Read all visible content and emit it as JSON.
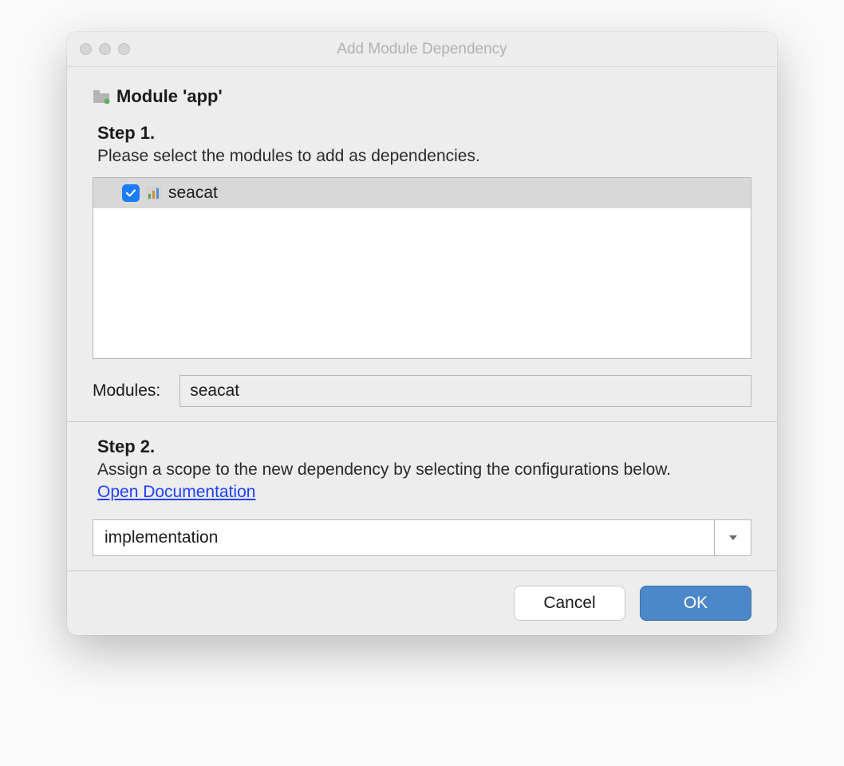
{
  "dialog": {
    "title": "Add Module Dependency",
    "module_header": "Module 'app'",
    "step1": {
      "label": "Step 1.",
      "desc": "Please select the modules to add as dependencies."
    },
    "module_list": [
      {
        "name": "seacat",
        "checked": true
      }
    ],
    "modules_label": "Modules:",
    "modules_value": "seacat",
    "step2": {
      "label": "Step 2.",
      "desc": "Assign a scope to the new dependency by selecting the configurations below.",
      "doc_link": "Open Documentation"
    },
    "scope_select": {
      "value": "implementation"
    },
    "buttons": {
      "cancel": "Cancel",
      "ok": "OK"
    }
  }
}
